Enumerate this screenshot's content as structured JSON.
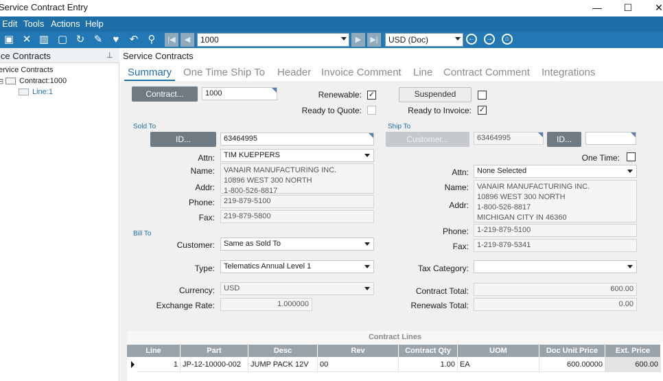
{
  "window": {
    "title": "Service Contract Entry"
  },
  "menu": [
    "Edit",
    "Tools",
    "Actions",
    "Help"
  ],
  "toolbar": {
    "record": "1000",
    "currency": "USD (Doc)"
  },
  "tree": {
    "header": "ice Contracts",
    "root": "ervice Contracts",
    "contract": "Contract:1000",
    "line": "Line:1"
  },
  "main": {
    "header": "Service Contracts",
    "tabs": [
      "Summary",
      "One Time Ship To",
      "Header",
      "Invoice Comment",
      "Line",
      "Contract Comment",
      "Integrations"
    ]
  },
  "form": {
    "contract_btn": "Contract...",
    "contract_num": "1000",
    "renewable_label": "Renewable:",
    "ready_quote_label": "Ready to Quote:",
    "suspended_btn": "Suspended",
    "ready_invoice_label": "Ready to Invoice:",
    "sold_to": {
      "section": "Sold To",
      "id_btn": "ID...",
      "id": "63464995",
      "attn_label": "Attn:",
      "attn": "TIM KUEPPERS",
      "name_label": "Name:",
      "addr_label": "Addr:",
      "address_lines": [
        "VANAIR MANUFACTURING INC.",
        "10896 WEST 300 NORTH",
        "1-800-526-8817"
      ],
      "phone_label": "Phone:",
      "phone": "219-879-5100",
      "fax_label": "Fax:",
      "fax": "219-879-5800"
    },
    "ship_to": {
      "section": "Ship To",
      "customer_btn": "Customer...",
      "customer_id": "63464995",
      "id_btn": "ID...",
      "one_time_label": "One Time:",
      "attn_label": "Attn:",
      "attn": "None Selected",
      "name_label": "Name:",
      "addr_label": "Addr:",
      "address_lines": [
        "VANAIR MANUFACTURING INC.",
        "10896 WEST 300 NORTH",
        "1-800-526-8817",
        "MICHIGAN CITY IN 46360"
      ],
      "phone_label": "Phone:",
      "phone": "1-219-879-5100",
      "fax_label": "Fax:",
      "fax": "1-219-879-5341"
    },
    "bill_to": {
      "section": "Bill To",
      "customer_label": "Customer:",
      "customer": "Same as Sold To"
    },
    "type_label": "Type:",
    "type": "Telematics Annual Level 1",
    "tax_category_label": "Tax Category:",
    "currency_label": "Currency:",
    "currency": "USD",
    "exchange_rate_label": "Exchange Rate:",
    "exchange_rate": "1.000000",
    "contract_total_label": "Contract Total:",
    "contract_total": "600.00",
    "renewals_total_label": "Renewals Total:",
    "renewals_total": "0.00"
  },
  "grid": {
    "title": "Contract Lines",
    "columns": [
      "Line",
      "Part",
      "Desc",
      "Rev",
      "Contract Qty",
      "UOM",
      "Doc Unit Price",
      "Ext. Price"
    ],
    "rows": [
      [
        "1",
        "JP-12-10000-002",
        "JUMP PACK 12V",
        "00",
        "1.00",
        "EA",
        "600.00000",
        "600.00"
      ]
    ]
  }
}
